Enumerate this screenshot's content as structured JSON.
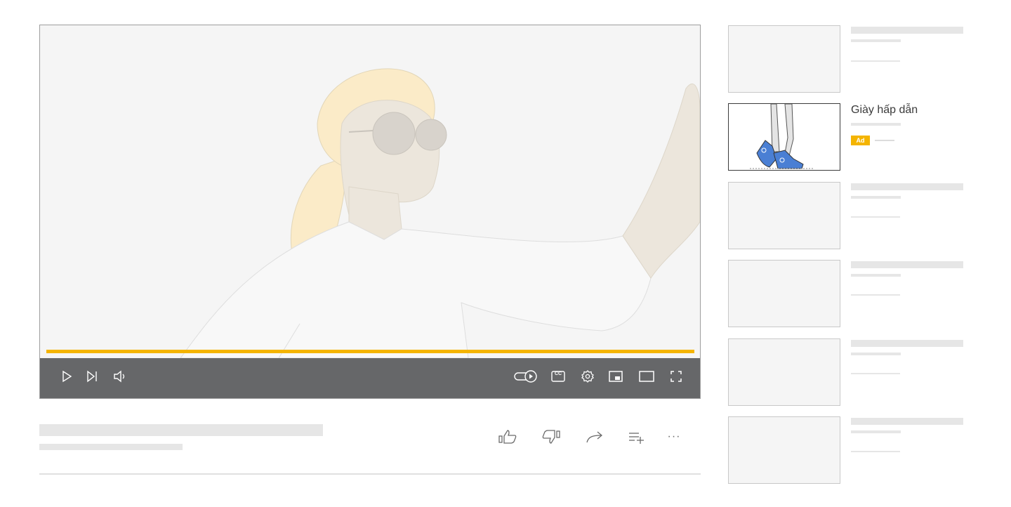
{
  "player": {
    "progress": 1.0,
    "accent_color": "#f4b400",
    "controls_bg": "#666769",
    "left_controls": [
      {
        "name": "play-icon"
      },
      {
        "name": "next-icon"
      },
      {
        "name": "volume-icon"
      }
    ],
    "right_controls": [
      {
        "name": "autoplay-toggle-icon"
      },
      {
        "name": "captions-icon",
        "label": "CC"
      },
      {
        "name": "settings-gear-icon"
      },
      {
        "name": "miniplayer-icon"
      },
      {
        "name": "theater-mode-icon"
      },
      {
        "name": "fullscreen-icon"
      }
    ]
  },
  "actions": [
    {
      "name": "like-icon"
    },
    {
      "name": "dislike-icon"
    },
    {
      "name": "share-icon"
    },
    {
      "name": "save-to-playlist-icon"
    },
    {
      "name": "more-icon",
      "label": "···"
    }
  ],
  "sidebar": {
    "ad": {
      "title": "Giày hấp dẫn",
      "badge": "Ad",
      "badge_color": "#f4b400"
    }
  }
}
